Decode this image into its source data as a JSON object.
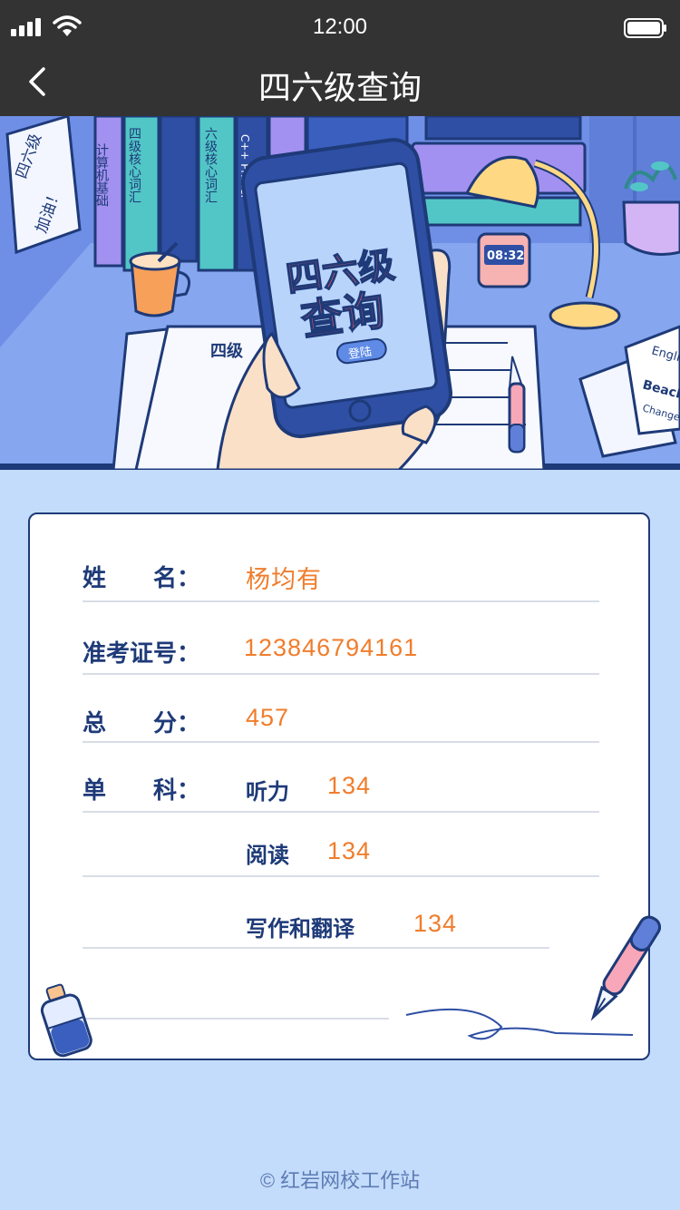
{
  "status": {
    "time": "12:00"
  },
  "nav": {
    "title": "四六级查询"
  },
  "banner": {
    "phone_title_1": "四六级",
    "phone_title_2": "查询",
    "login_label": "登陆",
    "clock_time": "08:32",
    "note_line1": "四六级",
    "note_line2": "加油！",
    "book1": "计算机基础",
    "book2": "四级核心词汇",
    "book3": "六级核心词汇",
    "book4": "C++ Primer",
    "paper_heading": "四级",
    "card_word1": "English",
    "card_word2": "Beach",
    "card_word3": "Change"
  },
  "result": {
    "name_label": "姓　　名：",
    "name_value": "杨均有",
    "ticket_label": "准考证号：",
    "ticket_value": "123846794161",
    "total_label": "总　　分：",
    "total_value": "457",
    "single_label": "单　　科：",
    "listening_label": "听力",
    "listening_value": "134",
    "reading_label": "阅读",
    "reading_value": "134",
    "writing_label": "写作和翻译",
    "writing_value": "134"
  },
  "footer": {
    "copyright": "© 红岩网校工作站"
  },
  "colors": {
    "navbar": "#333333",
    "label": "#1e3a78",
    "value": "#f07d2c",
    "background": "#c4dcfb"
  },
  "icons": [
    "signal-icon",
    "wifi-icon",
    "battery-icon",
    "back-icon",
    "pen-icon",
    "ink-bottle-icon"
  ]
}
